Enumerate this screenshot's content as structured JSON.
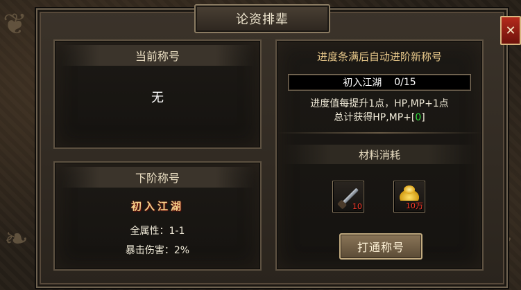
{
  "window": {
    "title": "论资排辈",
    "close_icon": "close-icon",
    "close_glyph": "✕"
  },
  "current_title": {
    "header": "当前称号",
    "value": "无"
  },
  "next_title": {
    "header": "下阶称号",
    "name": "初入江湖",
    "stats": [
      {
        "text": "全属性：1-1"
      },
      {
        "text": "暴击伤害：2%"
      }
    ]
  },
  "advance": {
    "header": "进度条满后自动进阶新称号",
    "progress": {
      "label": "初入江湖",
      "value": 0,
      "max": 15,
      "text": "0/15"
    },
    "desc_line1": "进度值每提升1点，HP,MP+1点",
    "desc_line2_prefix": "总计获得HP,MP+[",
    "desc_line2_value": "0",
    "desc_line2_suffix": "]"
  },
  "materials": {
    "header": "材料消耗",
    "items": [
      {
        "icon": "sword-item-icon",
        "count": "10"
      },
      {
        "icon": "gold-ingot-icon",
        "count": "10万"
      }
    ]
  },
  "action": {
    "label": "打通称号"
  },
  "colors": {
    "accent_gold": "#e8c88a",
    "green_value": "#2fdc3a",
    "red_count": "#ff3b2b",
    "close_red": "#b42a1c"
  }
}
